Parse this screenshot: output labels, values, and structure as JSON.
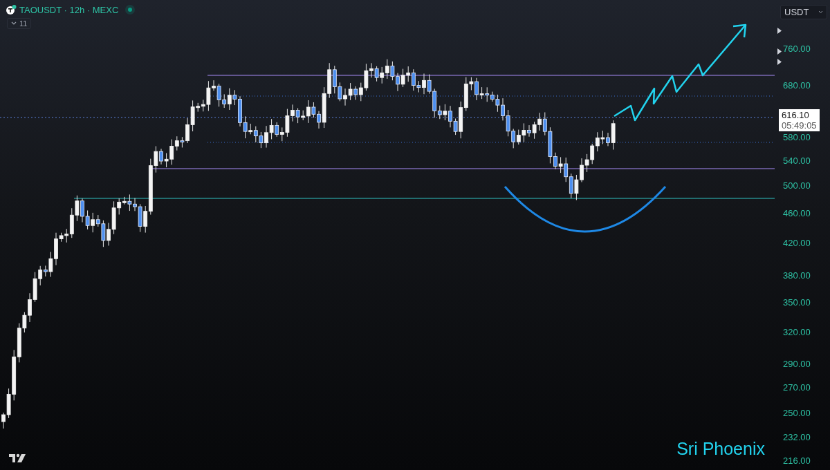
{
  "legend": {
    "symbol_title": "TAOUSDT · 12h · MEXC",
    "market_open": true
  },
  "indicators_toggle": {
    "count": "11",
    "expanded": false
  },
  "currency_select": {
    "value": "USDT"
  },
  "price_axis": {
    "ticks": [
      "760.00",
      "680.00",
      "580.00",
      "540.00",
      "500.00",
      "460.00",
      "420.00",
      "380.00",
      "350.00",
      "320.00",
      "290.00",
      "270.00",
      "250.00",
      "232.00",
      "216.00"
    ]
  },
  "price_tag": {
    "price": "616.10",
    "countdown": "05:49:05"
  },
  "signature": "Sri Phoenix"
}
